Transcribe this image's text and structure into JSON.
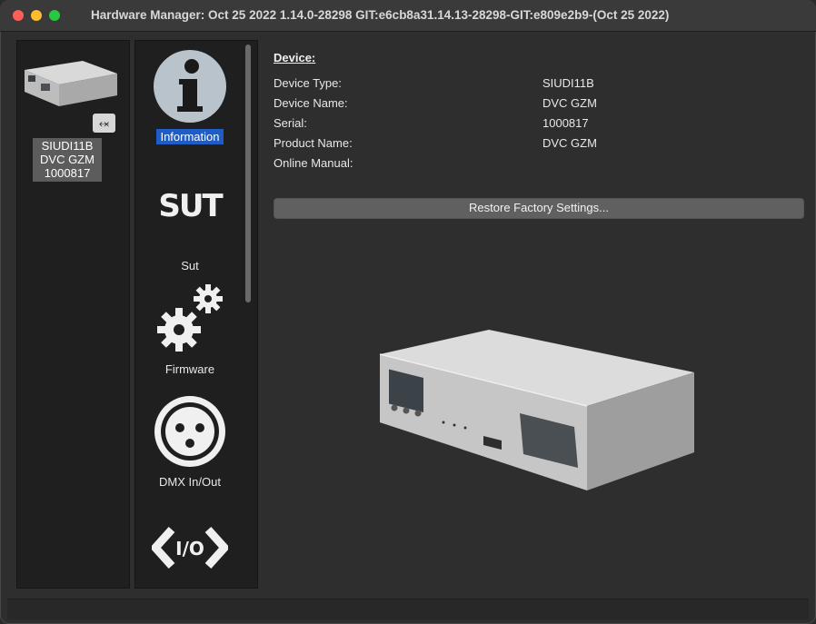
{
  "window": {
    "title": "Hardware Manager: Oct 25 2022 1.14.0-28298 GIT:e6cb8a31.14.13-28298-GIT:e809e2b9-(Oct 25 2022)"
  },
  "device_list": {
    "items": [
      {
        "type": "SIUDI11B",
        "name": "DVC GZM",
        "serial": "1000817",
        "connection_icon": "usb-icon"
      }
    ]
  },
  "nav": {
    "items": [
      {
        "label": "Information",
        "icon": "info-icon",
        "selected": true
      },
      {
        "label": "Sut",
        "icon": "sut-logo-icon",
        "selected": false
      },
      {
        "label": "Firmware",
        "icon": "gears-icon",
        "selected": false
      },
      {
        "label": "DMX In/Out",
        "icon": "dmx-connector-icon",
        "selected": false
      },
      {
        "label": "",
        "icon": "io-icon",
        "selected": false
      }
    ]
  },
  "details": {
    "section_title": "Device:",
    "rows": [
      {
        "label": "Device Type:",
        "value": "SIUDI11B"
      },
      {
        "label": "Device Name:",
        "value": "DVC GZM"
      },
      {
        "label": "Serial:",
        "value": "1000817"
      },
      {
        "label": "Product Name:",
        "value": "DVC GZM"
      },
      {
        "label": "Online Manual:",
        "value": ""
      }
    ],
    "restore_button": "Restore Factory Settings..."
  },
  "colors": {
    "selection": "#1f5cc7",
    "background": "#2e2e2e",
    "panel": "#1f1f1f"
  }
}
